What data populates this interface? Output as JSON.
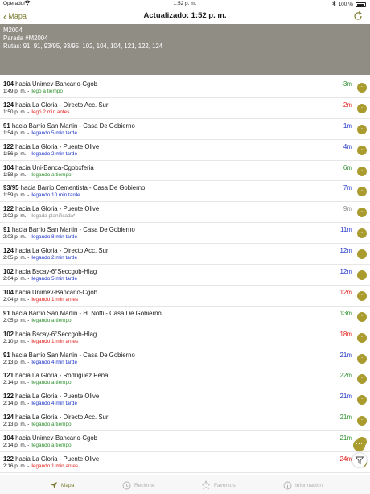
{
  "status_bar": {
    "carrier": "Operador",
    "time": "1:52 p. m.",
    "battery": "100 %"
  },
  "nav": {
    "back_label": "Mapa",
    "title": "Actualizado: 1:52 p. m."
  },
  "stop": {
    "code": "M2004",
    "stop_label": "Parada #M2004",
    "routes": "Rutas: 91, 91, 93/95, 93/95, 102, 104, 104, 121, 122, 124"
  },
  "arrivals": [
    {
      "route": "104",
      "dest": " hacia Unimev-Bancario-Cgob",
      "time": "1:49 p. m.",
      "status": "llegó a tiempo",
      "status_color": "green",
      "eta": "-3m",
      "eta_color": "green"
    },
    {
      "route": "124",
      "dest": " hacia La Gloria - Directo Acc. Sur",
      "time": "1:50 p. m.",
      "status": "llegó 2 min antes",
      "status_color": "red",
      "eta": "-2m",
      "eta_color": "red"
    },
    {
      "route": "91",
      "dest": " hacia Barrio San Martin  - Casa De Gobierno",
      "time": "1:54 p. m.",
      "status": "llegando 5 min tarde",
      "status_color": "blue",
      "eta": "1m",
      "eta_color": "blue"
    },
    {
      "route": "122",
      "dest": " hacia La Gloria - Puente Olive",
      "time": "1:56 p. m.",
      "status": "llegando 2 min tarde",
      "status_color": "blue",
      "eta": "4m",
      "eta_color": "blue"
    },
    {
      "route": "104",
      "dest": " hacia Uni-Banca-Cgobxferia",
      "time": "1:58 p. m.",
      "status": "llegando a tiempo",
      "status_color": "green",
      "eta": "6m",
      "eta_color": "green"
    },
    {
      "route": "93/95",
      "dest": " hacia Barrio Cementista - Casa De Gobierno",
      "time": "1:59 p. m.",
      "status": "llegando 10 min tarde",
      "status_color": "blue",
      "eta": "7m",
      "eta_color": "blue"
    },
    {
      "route": "122",
      "dest": " hacia La Gloria - Puente Olive",
      "time": "2:02 p. m.",
      "status": "llegada planificada*",
      "status_color": "gray",
      "eta": "9m",
      "eta_color": "gray"
    },
    {
      "route": "91",
      "dest": " hacia Barrio San Martin  - Casa De Gobierno",
      "time": "2:03 p. m.",
      "status": "llegando 8 min tarde",
      "status_color": "blue",
      "eta": "11m",
      "eta_color": "blue"
    },
    {
      "route": "124",
      "dest": " hacia La Gloria - Directo Acc. Sur",
      "time": "2:05 p. m.",
      "status": "llegando 2 min tarde",
      "status_color": "blue",
      "eta": "12m",
      "eta_color": "blue"
    },
    {
      "route": "102",
      "dest": " hacia Bscay-6°Seccgob-Hlag",
      "time": "2:04 p. m.",
      "status": "llegando 5 min tarde",
      "status_color": "blue",
      "eta": "12m",
      "eta_color": "blue"
    },
    {
      "route": "104",
      "dest": " hacia Unimev-Bancario-Cgob",
      "time": "2:04 p. m.",
      "status": "llegando 1 min antes",
      "status_color": "red",
      "eta": "12m",
      "eta_color": "red"
    },
    {
      "route": "91",
      "dest": " hacia Barrio San Martin - H. Notti - Casa De Gobierno",
      "time": "2:05 p. m.",
      "status": "llegando a tiempo",
      "status_color": "green",
      "eta": "13m",
      "eta_color": "green"
    },
    {
      "route": "102",
      "dest": " hacia Bscay-6°Seccgob-Hlag",
      "time": "2:10 p. m.",
      "status": "llegando 1 min antes",
      "status_color": "red",
      "eta": "18m",
      "eta_color": "red"
    },
    {
      "route": "91",
      "dest": " hacia Barrio San Martin  - Casa De Gobierno",
      "time": "2:13 p. m.",
      "status": "llegando 4 min tarde",
      "status_color": "blue",
      "eta": "21m",
      "eta_color": "blue"
    },
    {
      "route": "121",
      "dest": " hacia La Gloria - Rodriguez Peña",
      "time": "2:14 p. m.",
      "status": "llegando a tiempo",
      "status_color": "green",
      "eta": "22m",
      "eta_color": "green"
    },
    {
      "route": "122",
      "dest": " hacia La Gloria - Puente Olive",
      "time": "2:14 p. m.",
      "status": "llegando 4 min tarde",
      "status_color": "blue",
      "eta": "21m",
      "eta_color": "blue"
    },
    {
      "route": "124",
      "dest": " hacia La Gloria - Directo Acc. Sur",
      "time": "2:13 p. m.",
      "status": "llegando a tiempo",
      "status_color": "green",
      "eta": "21m",
      "eta_color": "green"
    },
    {
      "route": "104",
      "dest": " hacia Unimev-Bancario-Cgob",
      "time": "2:14 p. m.",
      "status": "llegando a tiempo",
      "status_color": "green",
      "eta": "21m",
      "eta_color": "green"
    },
    {
      "route": "122",
      "dest": " hacia La Gloria - Puente Olive",
      "time": "2:16 p. m.",
      "status": "llegando 1 min antes",
      "status_color": "red",
      "eta": "24m",
      "eta_color": "red"
    }
  ],
  "tabs": [
    {
      "label": "Mapa",
      "icon": "map-arrow-icon"
    },
    {
      "label": "Reciente",
      "icon": "clock-icon"
    },
    {
      "label": "Favoritos",
      "icon": "star-icon"
    },
    {
      "label": "Información",
      "icon": "info-icon"
    }
  ],
  "colors": {
    "accent": "#7b7a2e",
    "header_bg": "#8f8d84",
    "more_button": "#a99b2e",
    "green": "#2e8f2e",
    "red": "#e0201c",
    "blue": "#1f35c8",
    "gray": "#8a8a8a"
  }
}
